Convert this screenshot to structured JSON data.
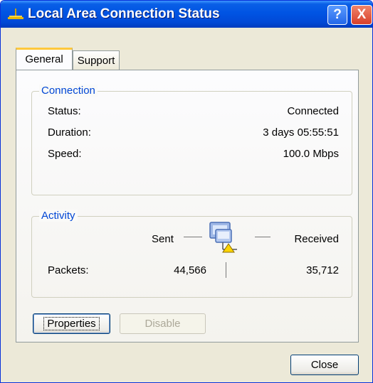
{
  "window": {
    "title": "Local Area Connection Status",
    "help_label": "?",
    "close_glyph": "X"
  },
  "tabs": [
    {
      "label": "General",
      "selected": true
    },
    {
      "label": "Support",
      "selected": false
    }
  ],
  "connection": {
    "legend": "Connection",
    "rows": [
      {
        "label": "Status:",
        "value": "Connected"
      },
      {
        "label": "Duration:",
        "value": "3 days 05:55:51"
      },
      {
        "label": "Speed:",
        "value": "100.0 Mbps"
      }
    ]
  },
  "activity": {
    "legend": "Activity",
    "sent_label": "Sent",
    "received_label": "Received",
    "packets_label": "Packets:",
    "packets_sent": "44,566",
    "packets_received": "35,712",
    "icon": "network-connection-icon"
  },
  "buttons": {
    "properties": "Properties",
    "disable": "Disable",
    "close": "Close"
  },
  "colors": {
    "titlebar": "#0054e3",
    "legend": "#0046d5",
    "tab_highlight": "#ffc83c",
    "face": "#ece9d8"
  }
}
